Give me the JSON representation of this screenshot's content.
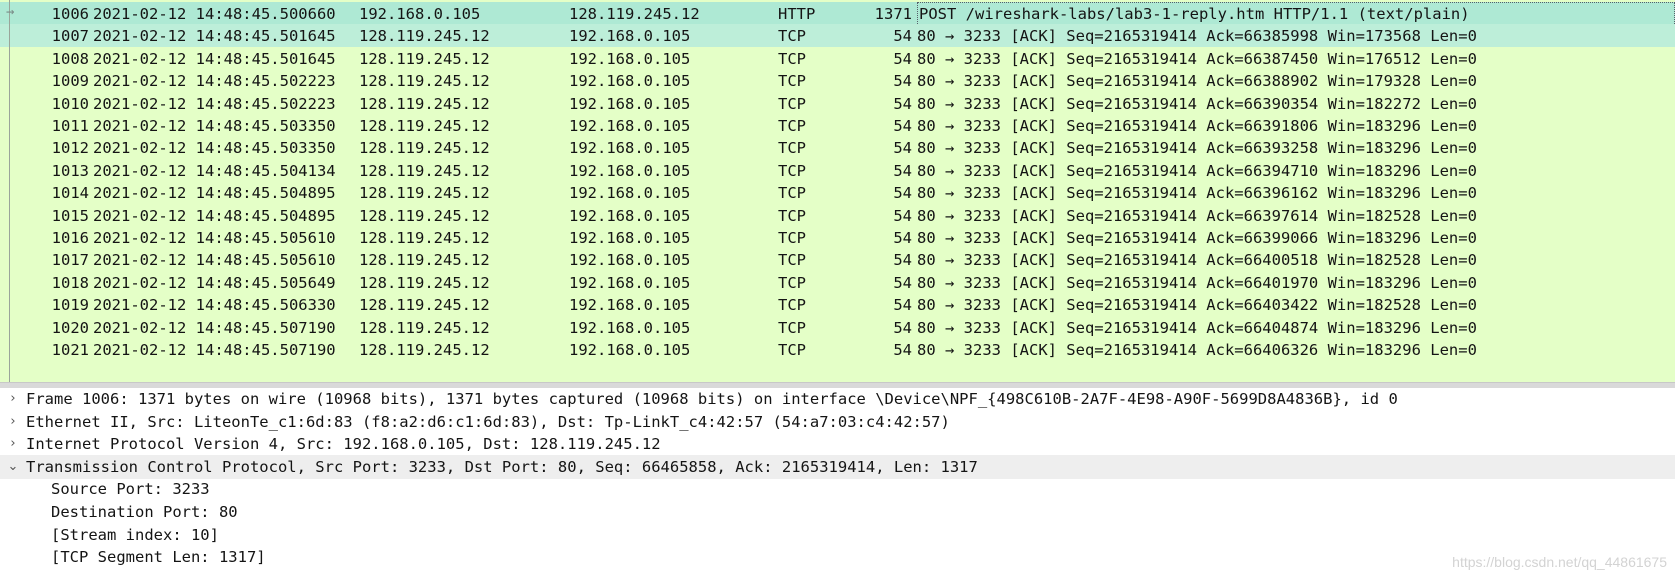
{
  "packet_list": {
    "rows": [
      {
        "no": "1006",
        "time": "2021-02-12 14:48:45.500660",
        "src": "192.168.0.105",
        "dst": "128.119.245.12",
        "proto": "HTTP",
        "len": "1371",
        "info": "POST /wireshark-labs/lab3-1-reply.htm HTTP/1.1  (text/plain)"
      },
      {
        "no": "1007",
        "time": "2021-02-12 14:48:45.501645",
        "src": "128.119.245.12",
        "dst": "192.168.0.105",
        "proto": "TCP",
        "len": "54",
        "info": "80 → 3233 [ACK] Seq=2165319414 Ack=66385998 Win=173568 Len=0"
      },
      {
        "no": "1008",
        "time": "2021-02-12 14:48:45.501645",
        "src": "128.119.245.12",
        "dst": "192.168.0.105",
        "proto": "TCP",
        "len": "54",
        "info": "80 → 3233 [ACK] Seq=2165319414 Ack=66387450 Win=176512 Len=0"
      },
      {
        "no": "1009",
        "time": "2021-02-12 14:48:45.502223",
        "src": "128.119.245.12",
        "dst": "192.168.0.105",
        "proto": "TCP",
        "len": "54",
        "info": "80 → 3233 [ACK] Seq=2165319414 Ack=66388902 Win=179328 Len=0"
      },
      {
        "no": "1010",
        "time": "2021-02-12 14:48:45.502223",
        "src": "128.119.245.12",
        "dst": "192.168.0.105",
        "proto": "TCP",
        "len": "54",
        "info": "80 → 3233 [ACK] Seq=2165319414 Ack=66390354 Win=182272 Len=0"
      },
      {
        "no": "1011",
        "time": "2021-02-12 14:48:45.503350",
        "src": "128.119.245.12",
        "dst": "192.168.0.105",
        "proto": "TCP",
        "len": "54",
        "info": "80 → 3233 [ACK] Seq=2165319414 Ack=66391806 Win=183296 Len=0"
      },
      {
        "no": "1012",
        "time": "2021-02-12 14:48:45.503350",
        "src": "128.119.245.12",
        "dst": "192.168.0.105",
        "proto": "TCP",
        "len": "54",
        "info": "80 → 3233 [ACK] Seq=2165319414 Ack=66393258 Win=183296 Len=0"
      },
      {
        "no": "1013",
        "time": "2021-02-12 14:48:45.504134",
        "src": "128.119.245.12",
        "dst": "192.168.0.105",
        "proto": "TCP",
        "len": "54",
        "info": "80 → 3233 [ACK] Seq=2165319414 Ack=66394710 Win=183296 Len=0"
      },
      {
        "no": "1014",
        "time": "2021-02-12 14:48:45.504895",
        "src": "128.119.245.12",
        "dst": "192.168.0.105",
        "proto": "TCP",
        "len": "54",
        "info": "80 → 3233 [ACK] Seq=2165319414 Ack=66396162 Win=183296 Len=0"
      },
      {
        "no": "1015",
        "time": "2021-02-12 14:48:45.504895",
        "src": "128.119.245.12",
        "dst": "192.168.0.105",
        "proto": "TCP",
        "len": "54",
        "info": "80 → 3233 [ACK] Seq=2165319414 Ack=66397614 Win=182528 Len=0"
      },
      {
        "no": "1016",
        "time": "2021-02-12 14:48:45.505610",
        "src": "128.119.245.12",
        "dst": "192.168.0.105",
        "proto": "TCP",
        "len": "54",
        "info": "80 → 3233 [ACK] Seq=2165319414 Ack=66399066 Win=183296 Len=0"
      },
      {
        "no": "1017",
        "time": "2021-02-12 14:48:45.505610",
        "src": "128.119.245.12",
        "dst": "192.168.0.105",
        "proto": "TCP",
        "len": "54",
        "info": "80 → 3233 [ACK] Seq=2165319414 Ack=66400518 Win=182528 Len=0"
      },
      {
        "no": "1018",
        "time": "2021-02-12 14:48:45.505649",
        "src": "128.119.245.12",
        "dst": "192.168.0.105",
        "proto": "TCP",
        "len": "54",
        "info": "80 → 3233 [ACK] Seq=2165319414 Ack=66401970 Win=183296 Len=0"
      },
      {
        "no": "1019",
        "time": "2021-02-12 14:48:45.506330",
        "src": "128.119.245.12",
        "dst": "192.168.0.105",
        "proto": "TCP",
        "len": "54",
        "info": "80 → 3233 [ACK] Seq=2165319414 Ack=66403422 Win=182528 Len=0"
      },
      {
        "no": "1020",
        "time": "2021-02-12 14:48:45.507190",
        "src": "128.119.245.12",
        "dst": "192.168.0.105",
        "proto": "TCP",
        "len": "54",
        "info": "80 → 3233 [ACK] Seq=2165319414 Ack=66404874 Win=183296 Len=0"
      },
      {
        "no": "1021",
        "time": "2021-02-12 14:48:45.507190",
        "src": "128.119.245.12",
        "dst": "192.168.0.105",
        "proto": "TCP",
        "len": "54",
        "info": "80 → 3233 [ACK] Seq=2165319414 Ack=66406326 Win=183296 Len=0"
      }
    ]
  },
  "details": {
    "lines": [
      {
        "chevron": "›",
        "text": "Frame 1006: 1371 bytes on wire (10968 bits), 1371 bytes captured (10968 bits) on interface \\Device\\NPF_{498C610B-2A7F-4E98-A90F-5699D8A4836B}, id 0"
      },
      {
        "chevron": "›",
        "text": "Ethernet II, Src: LiteonTe_c1:6d:83 (f8:a2:d6:c1:6d:83), Dst: Tp-LinkT_c4:42:57 (54:a7:03:c4:42:57)"
      },
      {
        "chevron": "›",
        "text": "Internet Protocol Version 4, Src: 192.168.0.105, Dst: 128.119.245.12"
      },
      {
        "chevron": "⌄",
        "text": "Transmission Control Protocol, Src Port: 3233, Dst Port: 80, Seq: 66465858, Ack: 2165319414, Len: 1317"
      },
      {
        "chevron": "",
        "text": "Source Port: 3233"
      },
      {
        "chevron": "",
        "text": "Destination Port: 80"
      },
      {
        "chevron": "",
        "text": "[Stream index: 10]"
      },
      {
        "chevron": "",
        "text": "[TCP Segment Len: 1317]"
      }
    ]
  },
  "watermark": "https://blog.csdn.net/qq_44861675",
  "colors": {
    "tcp_row_bg": "#e4ffc7",
    "selected_row_bg": "#aee9d4",
    "highlight_detail_bg": "#eeeeee"
  },
  "icons": {
    "frame_arrow": "→"
  }
}
